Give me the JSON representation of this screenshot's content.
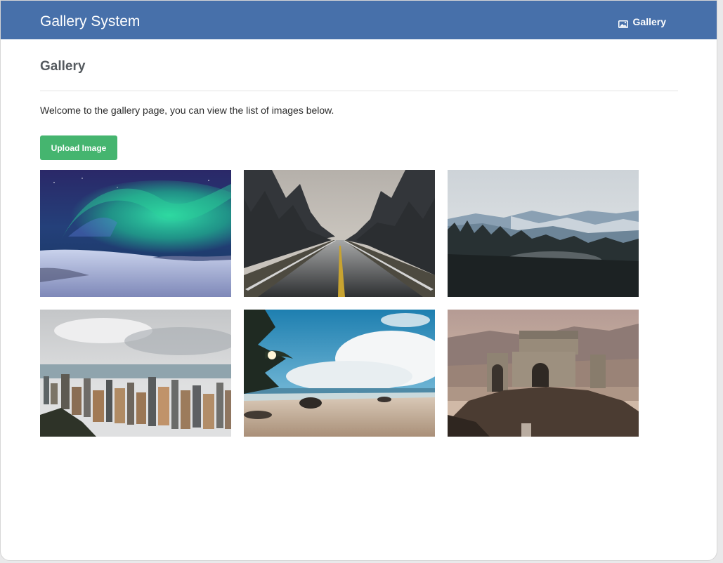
{
  "app": {
    "title": "Gallery System",
    "brand_color": "#4770aa"
  },
  "navbar": {
    "gallery_link": {
      "label": "Gallery",
      "icon": "image-icon"
    }
  },
  "page": {
    "title": "Gallery",
    "welcome_text": "Welcome to the gallery page, you can view the list of images below.",
    "upload_button": {
      "label": "Upload Image",
      "color": "#45b56f"
    }
  },
  "gallery": {
    "images": [
      {
        "subject": "aurora-borealis-over-snow"
      },
      {
        "subject": "foggy-forest-road"
      },
      {
        "subject": "misty-mountain-forest"
      },
      {
        "subject": "city-skyline-aerial"
      },
      {
        "subject": "tropical-beach-with-clouds"
      },
      {
        "subject": "stone-ruins-on-hill"
      }
    ]
  }
}
